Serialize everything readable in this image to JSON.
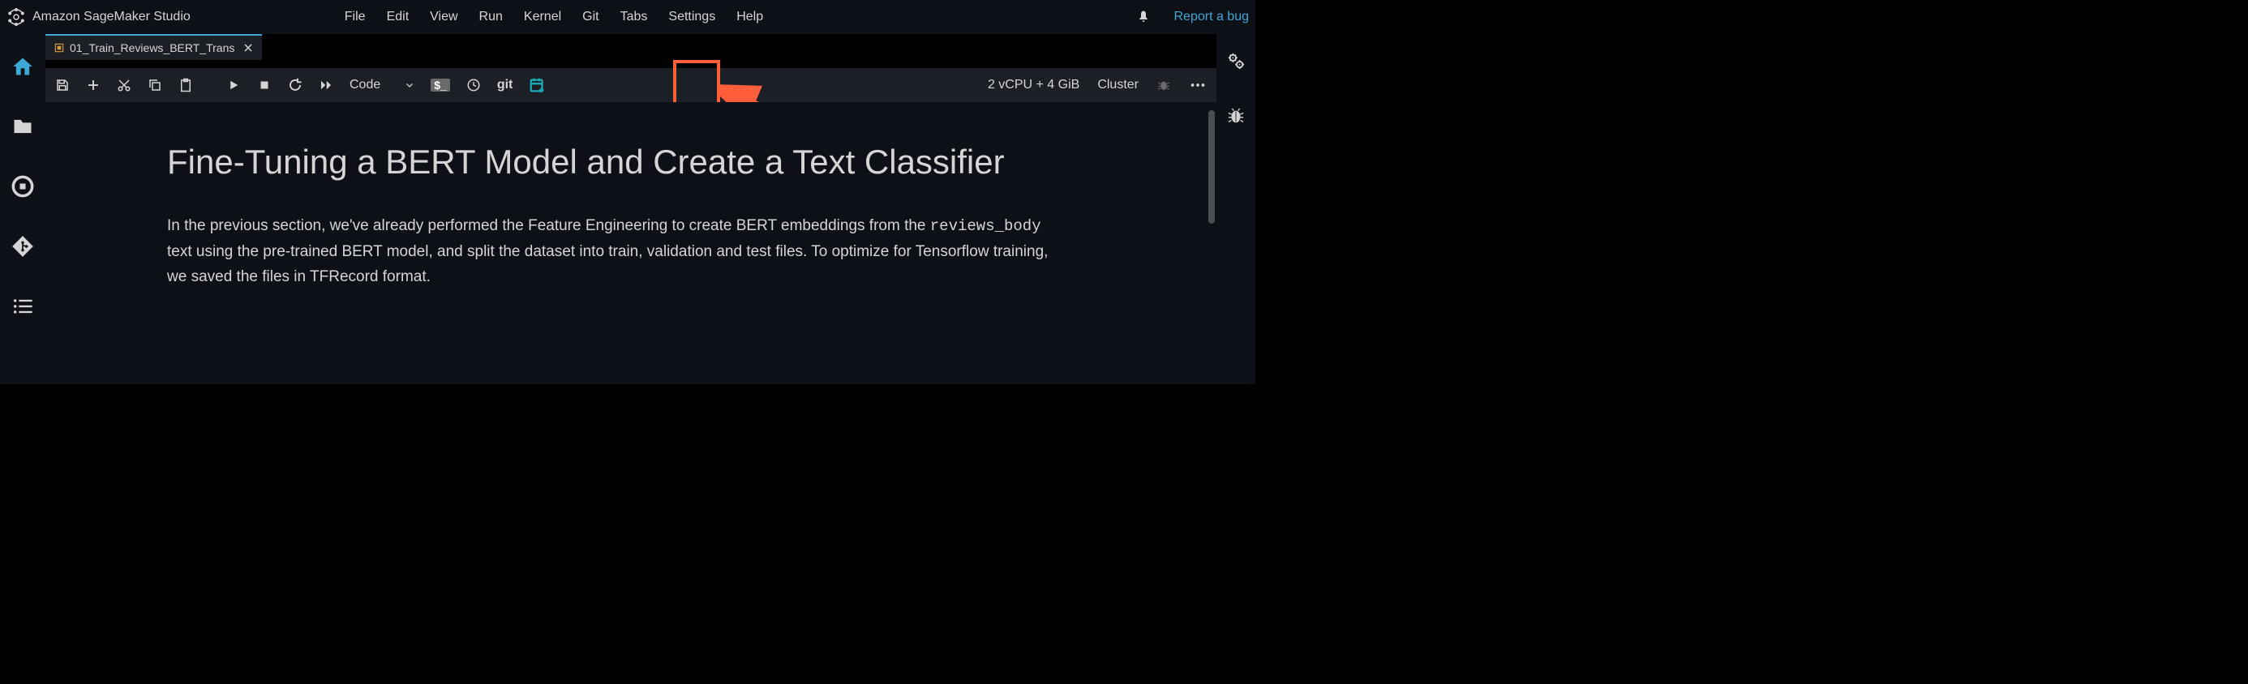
{
  "header": {
    "app_title": "Amazon SageMaker Studio",
    "menu": [
      "File",
      "Edit",
      "View",
      "Run",
      "Kernel",
      "Git",
      "Tabs",
      "Settings",
      "Help"
    ],
    "report_bug": "Report a bug"
  },
  "tab": {
    "label": "01_Train_Reviews_BERT_Trans"
  },
  "toolbar": {
    "cell_type": "Code",
    "git_label": "git",
    "terminal_badge": "$_",
    "compute": "2 vCPU + 4 GiB",
    "cluster": "Cluster"
  },
  "document": {
    "title": "Fine-Tuning a BERT Model and Create a Text Classifier",
    "para_prefix": "In the previous section, we've already performed the Feature Engineering to create BERT embeddings from the ",
    "code_span": "reviews_body",
    "para_suffix": " text using the pre-trained BERT model, and split the dataset into train, validation and test files. To optimize for Tensorflow training, we saved the files in TFRecord format."
  }
}
